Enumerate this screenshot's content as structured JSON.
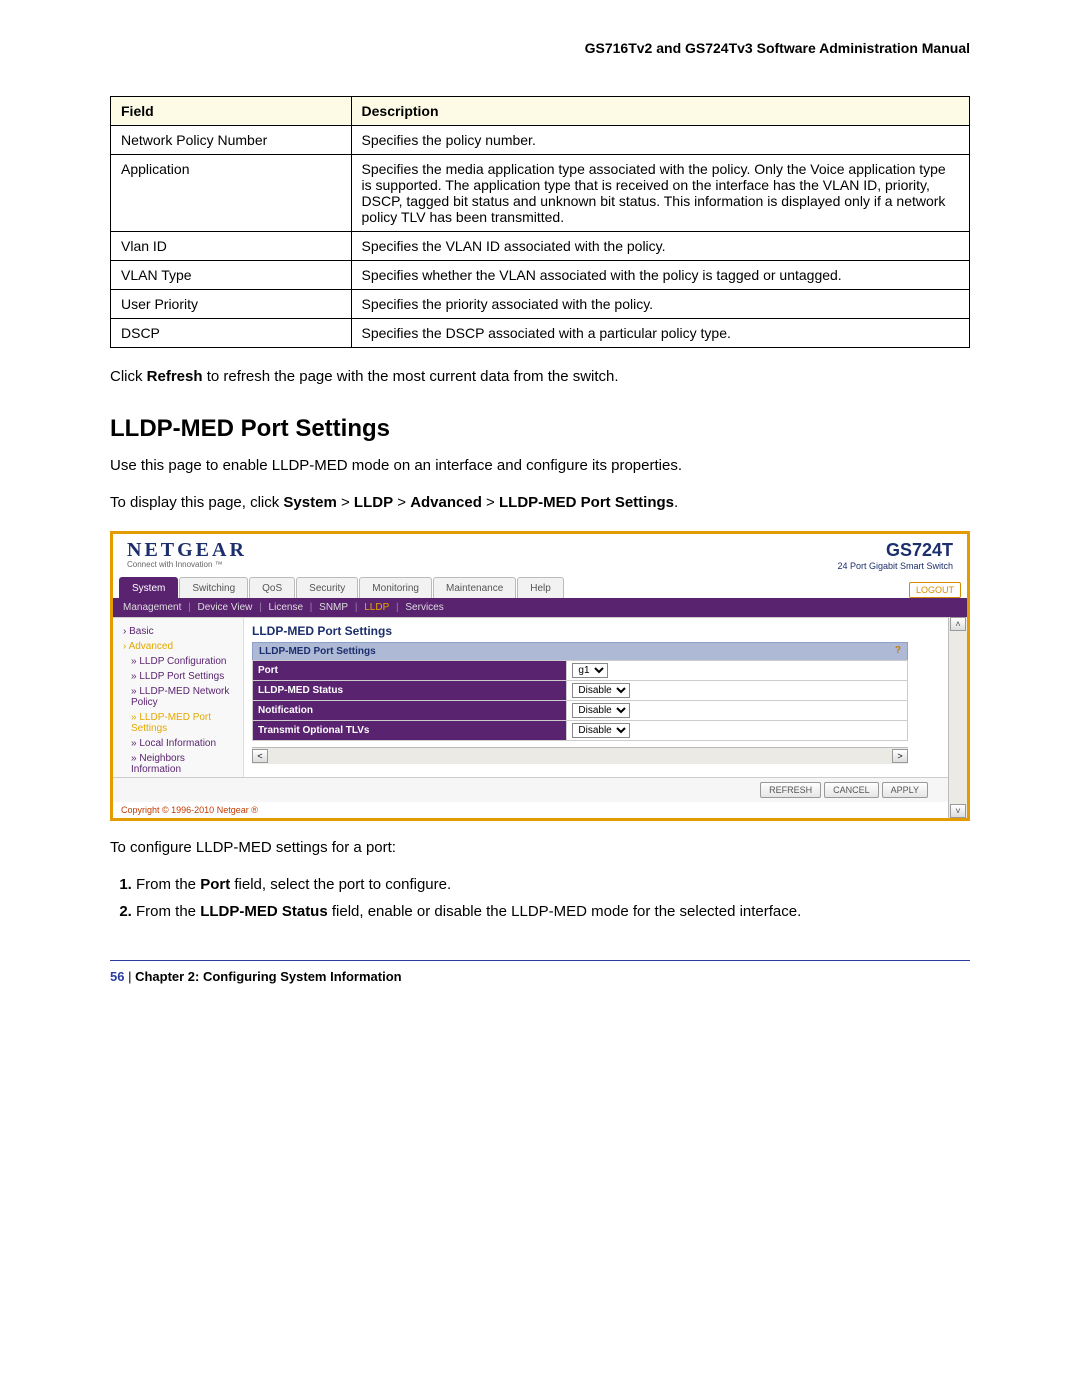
{
  "doc_header": "GS716Tv2 and GS724Tv3 Software Administration Manual",
  "field_table": {
    "head_field": "Field",
    "head_desc": "Description",
    "rows": [
      {
        "field": "Network Policy Number",
        "desc": "Specifies the policy number."
      },
      {
        "field": "Application",
        "desc": "Specifies the media application type associated with the policy. Only the Voice application type is supported. The application type that is received on the interface has the VLAN ID, priority, DSCP, tagged bit status and unknown bit status. This information is displayed only if a network policy TLV has been transmitted."
      },
      {
        "field": "Vlan ID",
        "desc": "Specifies the VLAN ID associated with the policy."
      },
      {
        "field": "VLAN Type",
        "desc": "Specifies whether the VLAN associated with the policy is tagged or untagged."
      },
      {
        "field": "User Priority",
        "desc": "Specifies the priority associated with the policy."
      },
      {
        "field": "DSCP",
        "desc": "Specifies the DSCP associated with a particular policy type."
      }
    ]
  },
  "p_refresh_pre": "Click ",
  "p_refresh_bold": "Refresh",
  "p_refresh_post": " to refresh the page with the most current data from the switch.",
  "section_heading": "LLDP-MED Port Settings",
  "p_intro": "Use this page to enable LLDP-MED mode on an interface and configure its properties.",
  "p_nav_pre": "To display this page, click ",
  "nav_parts": [
    "System",
    "LLDP",
    "Advanced",
    "LLDP-MED Port Settings"
  ],
  "nav_sep": " > ",
  "screenshot": {
    "logo": "NETGEAR",
    "logo_tag": "Connect with Innovation ™",
    "model": "GS724T",
    "model_sub": "24 Port Gigabit Smart Switch",
    "tabs": [
      "System",
      "Switching",
      "QoS",
      "Security",
      "Monitoring",
      "Maintenance",
      "Help"
    ],
    "active_tab": 0,
    "logout": "LOGOUT",
    "subtabs": [
      "Management",
      "Device View",
      "License",
      "SNMP",
      "LLDP",
      "Services"
    ],
    "subtab_sel": 4,
    "sidebar": [
      {
        "t": "hdr",
        "label": "Basic"
      },
      {
        "t": "hdr",
        "label": "Advanced",
        "sel": true
      },
      {
        "t": "sub",
        "label": "LLDP Configuration"
      },
      {
        "t": "sub",
        "label": "LLDP Port Settings"
      },
      {
        "t": "sub",
        "label": "LLDP-MED Network Policy"
      },
      {
        "t": "sub",
        "label": "LLDP-MED Port Settings",
        "sel": true
      },
      {
        "t": "sub",
        "label": "Local Information"
      },
      {
        "t": "sub",
        "label": "Neighbors Information"
      }
    ],
    "panel_title": "LLDP-MED Port Settings",
    "box_header": "LLDP-MED Port Settings",
    "rows": [
      {
        "label": "Port",
        "kind": "select",
        "value": "g1"
      },
      {
        "label": "LLDP-MED Status",
        "kind": "select",
        "value": "Disable"
      },
      {
        "label": "Notification",
        "kind": "select",
        "value": "Disable"
      },
      {
        "label": "Transmit Optional TLVs",
        "kind": "select",
        "value": "Disable"
      }
    ],
    "buttons": [
      "REFRESH",
      "CANCEL",
      "APPLY"
    ],
    "copyright": "Copyright © 1996-2010 Netgear ®"
  },
  "p_configure": "To configure LLDP-MED settings for a port:",
  "steps": [
    {
      "pre": "From the ",
      "b": "Port",
      "post": " field, select the port to configure."
    },
    {
      "pre": "From the ",
      "b": "LLDP-MED Status",
      "post": " field, enable or disable the LLDP-MED mode for the selected interface."
    }
  ],
  "footer": {
    "page": "56",
    "sep": "   |   ",
    "chapter": "Chapter 2:  Configuring System Information"
  }
}
